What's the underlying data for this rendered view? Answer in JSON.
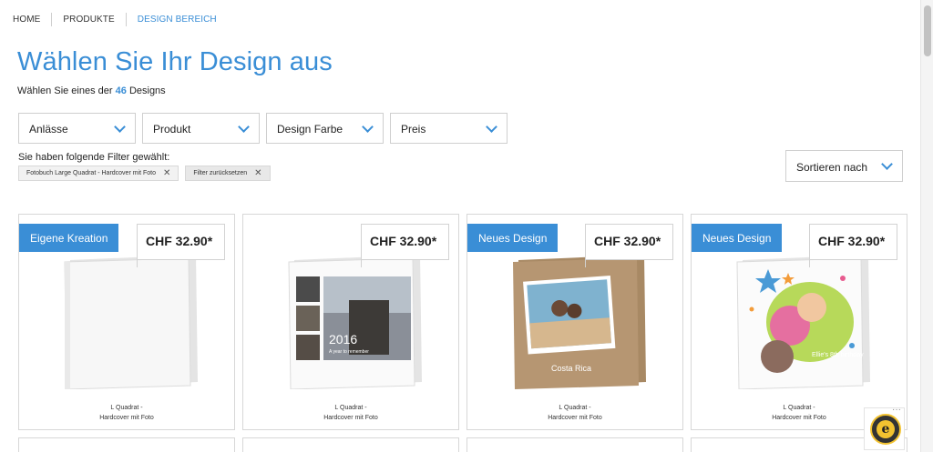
{
  "breadcrumb": [
    "HOME",
    "PRODUKTE",
    "DESIGN BEREICH"
  ],
  "title": "Wählen Sie Ihr Design aus",
  "subtitle": {
    "prefix": "Wählen Sie eines der",
    "count": "46",
    "suffix": "Designs"
  },
  "filters": [
    "Anlässe",
    "Produkt",
    "Design Farbe",
    "Preis"
  ],
  "filter_label": "Sie haben folgende Filter gewählt:",
  "chips": [
    "Fotobuch Large Quadrat - Hardcover mit Foto",
    "Filter zurücksetzen"
  ],
  "sort_label": "Sortieren nach",
  "products": [
    {
      "badge": "Eigene Kreation",
      "price": "CHF 32.90*",
      "caption_1": "L Quadrat -",
      "caption_2": "Hardcover mit Foto"
    },
    {
      "badge": "",
      "price": "CHF 32.90*",
      "caption_1": "L Quadrat -",
      "caption_2": "Hardcover mit Foto",
      "cover_year": "2016",
      "cover_sub": "A year to remember"
    },
    {
      "badge": "Neues Design",
      "price": "CHF 32.90*",
      "caption_1": "L Quadrat -",
      "caption_2": "Hardcover mit Foto",
      "cover_place": "Costa Rica"
    },
    {
      "badge": "Neues Design",
      "price": "CHF 32.90*",
      "caption_1": "L Quadrat -",
      "caption_2": "Hardcover mit Foto",
      "cover_text": "Ellie's 8th birthday"
    }
  ],
  "colors": {
    "accent": "#3a8ed6",
    "border": "#d7d7d7"
  }
}
